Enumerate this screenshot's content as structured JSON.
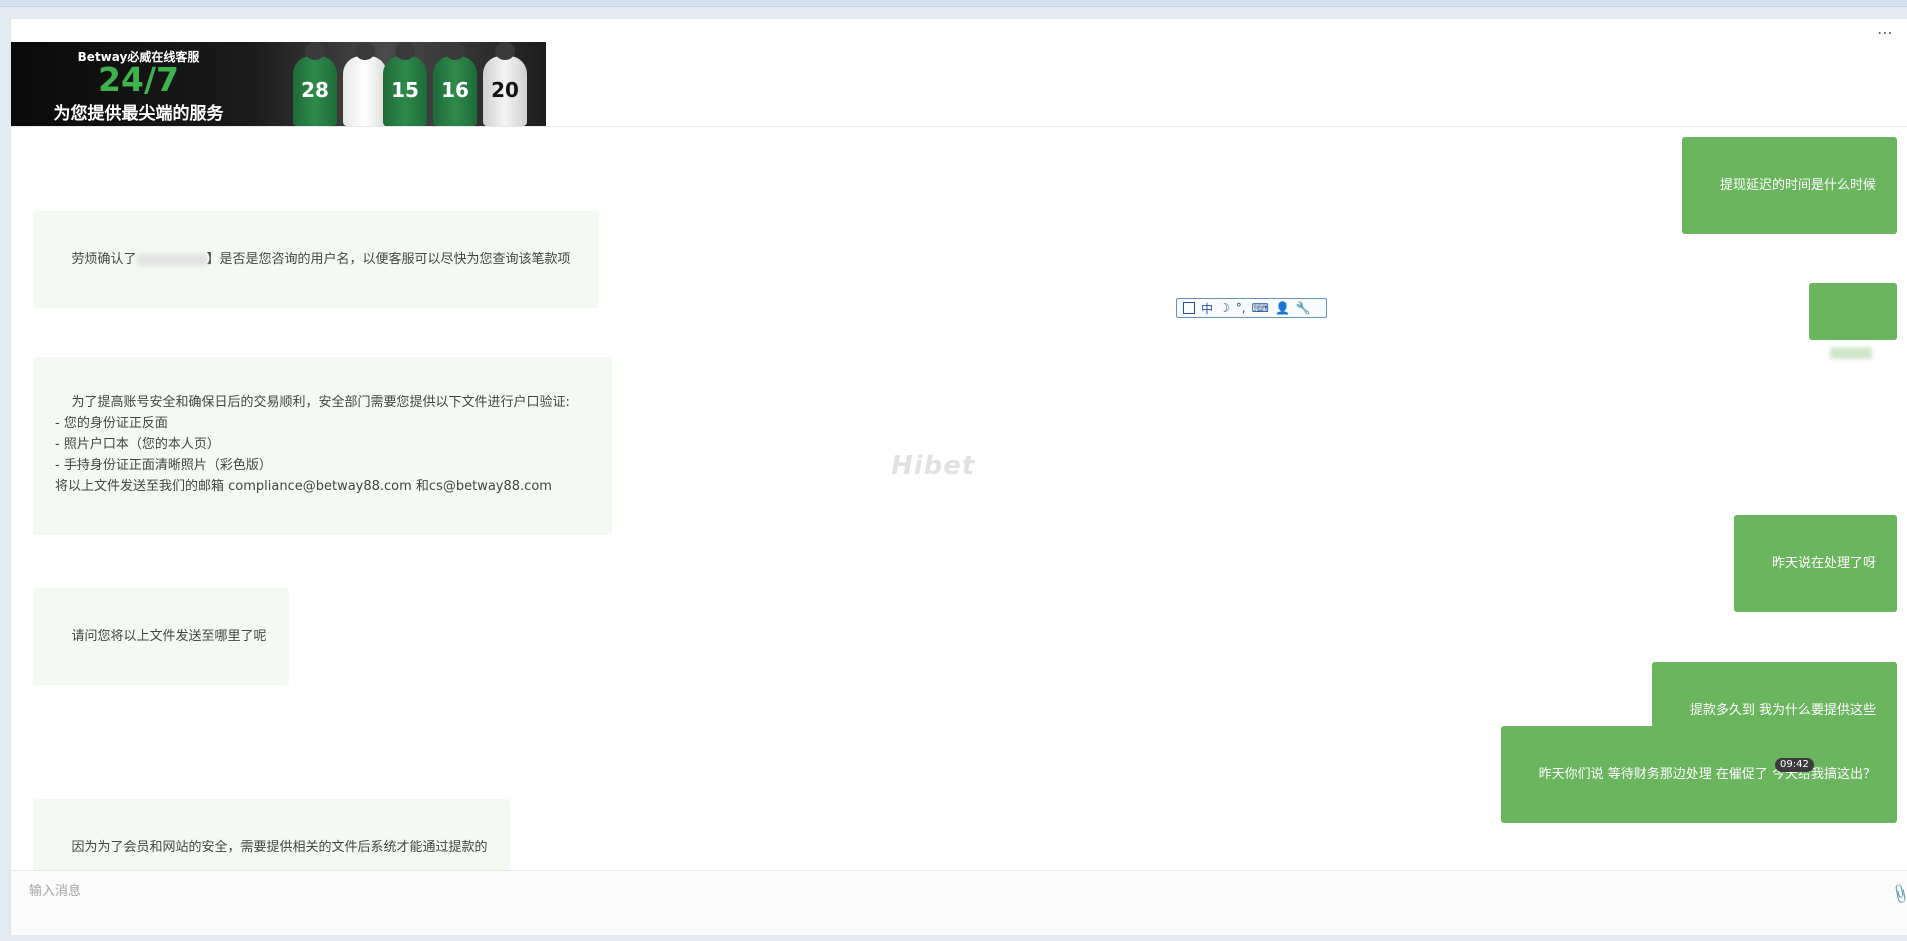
{
  "banner": {
    "line1": "Betway必威在线客服",
    "line2": "24/7",
    "line3": "为您提供最尖端的服务",
    "jersey_numbers": [
      "28",
      "",
      "15",
      "16",
      "20"
    ]
  },
  "messages": [
    {
      "side": "right",
      "text": "提现延迟的时间是什么时候"
    },
    {
      "side": "left",
      "text_before": "劳烦确认了",
      "text_after": "】是否是您咨询的用户名，以便客服可以尽快为您查询该笔款项"
    },
    {
      "side": "right",
      "text": ""
    },
    {
      "side": "left",
      "text": "为了提高账号安全和确保日后的交易顺利，安全部门需要您提供以下文件进行户口验证:\n- 您的身份证正反面\n- 照片户口本（您的本人页）\n- 手持身份证正面清晰照片（彩色版）\n将以上文件发送至我们的邮箱 compliance@betway88.com 和cs@betway88.com"
    },
    {
      "side": "right",
      "text": "昨天说在处理了呀"
    },
    {
      "side": "left",
      "text": "请问您将以上文件发送至哪里了呢"
    },
    {
      "side": "right",
      "text": "提款多久到 我为什么要提供这些"
    },
    {
      "side": "right",
      "text": "昨天你们说 等待财务那边处理 在催促了 今天给我搞这出？"
    },
    {
      "side": "left",
      "text": "因为为了会员和网站的安全，需要提供相关的文件后系统才能通过提款的"
    }
  ],
  "timestamp": "09:42",
  "ime_toolbar": {
    "label": "中",
    "punct": "°,"
  },
  "watermark": "Hibet",
  "input": {
    "placeholder": "输入消息",
    "value": ""
  },
  "icons": {
    "more": "more-icon",
    "attach": "paperclip-icon"
  },
  "colors": {
    "user_bubble": "#6ab55e",
    "agent_bubble": "#f4f9f3",
    "brand_green": "#3fb24d"
  }
}
